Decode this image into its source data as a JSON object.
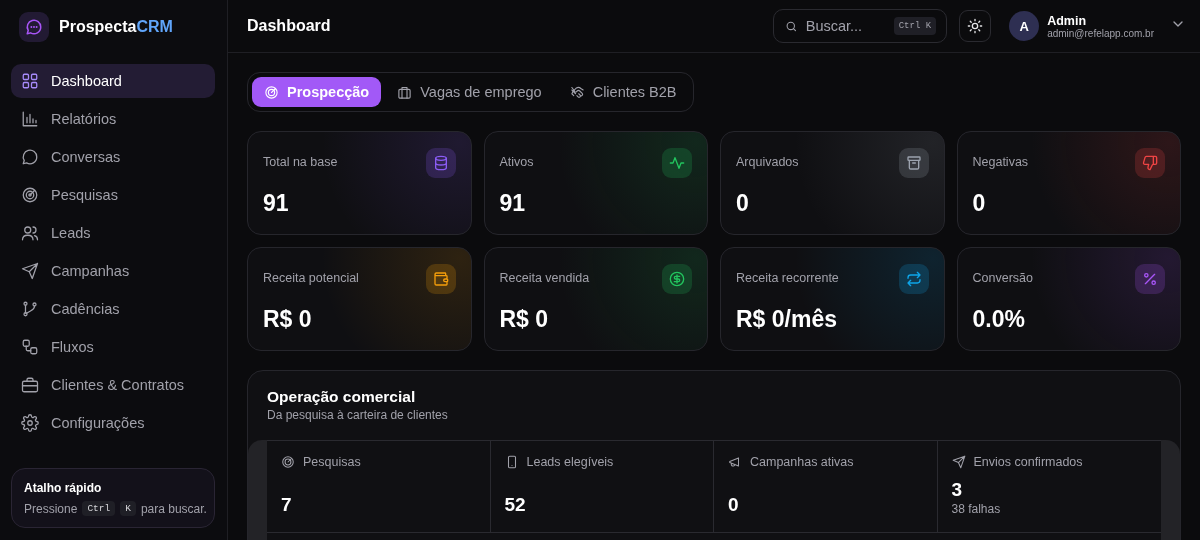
{
  "brand": {
    "name": "Prospecta",
    "suffix": "CRM"
  },
  "sidebar": {
    "items": [
      {
        "label": "Dashboard",
        "selected": true
      },
      {
        "label": "Relatórios",
        "selected": false
      },
      {
        "label": "Conversas",
        "selected": false
      },
      {
        "label": "Pesquisas",
        "selected": false
      },
      {
        "label": "Leads",
        "selected": false
      },
      {
        "label": "Campanhas",
        "selected": false
      },
      {
        "label": "Cadências",
        "selected": false
      },
      {
        "label": "Fluxos",
        "selected": false
      },
      {
        "label": "Clientes & Contratos",
        "selected": false
      },
      {
        "label": "Configurações",
        "selected": false
      }
    ],
    "shortcut_card": {
      "title": "Atalho rápido",
      "before": "Pressione",
      "keys": [
        "Ctrl",
        "K"
      ],
      "after": "para buscar."
    }
  },
  "header": {
    "title": "Dashboard",
    "search": {
      "placeholder": "Buscar...",
      "shortcut": "Ctrl K"
    },
    "user": {
      "initial": "A",
      "name": "Admin",
      "email": "admin@refelapp.com.br"
    }
  },
  "tabs": [
    {
      "label": "Prospecção",
      "selected": true
    },
    {
      "label": "Vagas de emprego",
      "selected": false
    },
    {
      "label": "Clientes B2B",
      "selected": false
    }
  ],
  "stats": [
    {
      "label": "Total na base",
      "value": "91",
      "color": "#8b5cf6"
    },
    {
      "label": "Ativos",
      "value": "91",
      "color": "#22c55e"
    },
    {
      "label": "Arquivados",
      "value": "0",
      "color": "#9ca3af"
    },
    {
      "label": "Negativas",
      "value": "0",
      "color": "#ef4444"
    },
    {
      "label": "Receita potencial",
      "value": "R$ 0",
      "color": "#f59e0b"
    },
    {
      "label": "Receita vendida",
      "value": "R$ 0",
      "color": "#22c55e"
    },
    {
      "label": "Receita recorrente",
      "value": "R$ 0/mês",
      "color": "#0ea5e9"
    },
    {
      "label": "Conversão",
      "value": "0.0%",
      "color": "#a855f7"
    }
  ],
  "operation": {
    "title": "Operação comercial",
    "subtitle": "Da pesquisa à carteira de clientes",
    "metrics": [
      {
        "label": "Pesquisas",
        "value": "7"
      },
      {
        "label": "Leads elegíveis",
        "value": "52"
      },
      {
        "label": "Campanhas ativas",
        "value": "0"
      },
      {
        "label": "Envios confirmados",
        "value": "3",
        "note": "38 falhas"
      }
    ]
  }
}
